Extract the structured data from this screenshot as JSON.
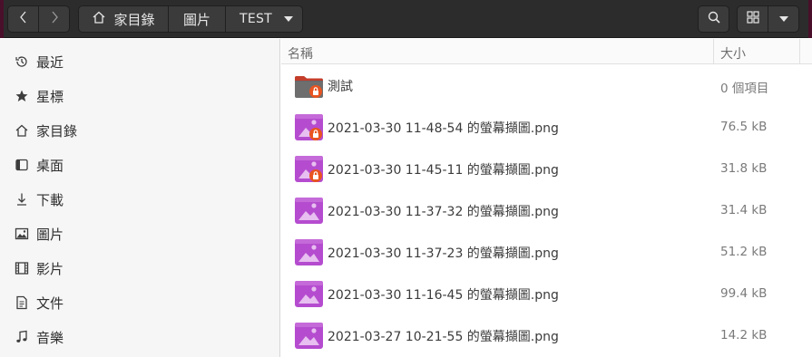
{
  "headerbar": {
    "breadcrumbs": [
      {
        "label": "家目錄"
      },
      {
        "label": "圖片"
      },
      {
        "label": "TEST"
      }
    ],
    "buttons": {
      "back_icon": "chevron-left-icon",
      "forward_icon": "chevron-right-icon",
      "search_icon": "search-icon",
      "view_icon": "grid-view-icon",
      "view_menu_icon": "triangle-down-icon"
    }
  },
  "sidebar": {
    "items": [
      {
        "label": "最近",
        "icon": "clock-icon"
      },
      {
        "label": "星標",
        "icon": "star-icon"
      },
      {
        "label": "家目錄",
        "icon": "home-icon"
      },
      {
        "label": "桌面",
        "icon": "desktop-icon"
      },
      {
        "label": "下載",
        "icon": "download-icon"
      },
      {
        "label": "圖片",
        "icon": "image-icon"
      },
      {
        "label": "影片",
        "icon": "film-icon"
      },
      {
        "label": "文件",
        "icon": "document-icon"
      },
      {
        "label": "音樂",
        "icon": "music-icon"
      }
    ]
  },
  "file_list": {
    "columns": {
      "name": "名稱",
      "size": "大小"
    },
    "rows": [
      {
        "name": "測試",
        "size": "0 個項目",
        "kind": "folder",
        "locked": true
      },
      {
        "name": "2021-03-30 11-48-54 的螢幕擷圖.png",
        "size": "76.5 kB",
        "kind": "image",
        "locked": true
      },
      {
        "name": "2021-03-30 11-45-11 的螢幕擷圖.png",
        "size": "31.8 kB",
        "kind": "image",
        "locked": true
      },
      {
        "name": "2021-03-30 11-37-32 的螢幕擷圖.png",
        "size": "31.4 kB",
        "kind": "image",
        "locked": false
      },
      {
        "name": "2021-03-30 11-37-23 的螢幕擷圖.png",
        "size": "51.2 kB",
        "kind": "image",
        "locked": false
      },
      {
        "name": "2021-03-30 11-16-45 的螢幕擷圖.png",
        "size": "99.4 kB",
        "kind": "image",
        "locked": false
      },
      {
        "name": "2021-03-27 10-21-55 的螢幕擷圖.png",
        "size": "14.2 kB",
        "kind": "image",
        "locked": false
      }
    ]
  },
  "colors": {
    "headerbar": "#2c2c2c",
    "sidebar": "#f6f6f6",
    "image_icon": "#b54ccf",
    "folder_icon": "#6e6e6e",
    "lock_badge": "#e95420"
  }
}
